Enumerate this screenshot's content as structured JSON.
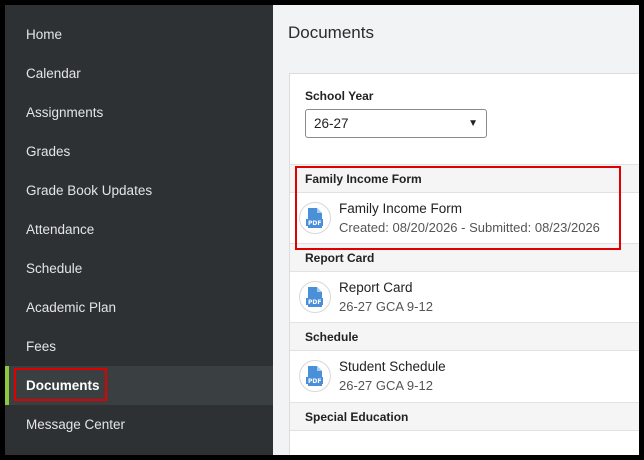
{
  "sidebar": {
    "items": [
      {
        "label": "Home"
      },
      {
        "label": "Calendar"
      },
      {
        "label": "Assignments"
      },
      {
        "label": "Grades"
      },
      {
        "label": "Grade Book Updates"
      },
      {
        "label": "Attendance"
      },
      {
        "label": "Schedule"
      },
      {
        "label": "Academic Plan"
      },
      {
        "label": "Fees"
      },
      {
        "label": "Documents"
      },
      {
        "label": "Message Center"
      }
    ],
    "active": "Documents"
  },
  "main": {
    "title": "Documents",
    "school_year": {
      "label": "School Year",
      "selected": "26-27"
    },
    "sections": [
      {
        "header": "Family Income Form",
        "docs": [
          {
            "title": "Family Income Form",
            "subtitle": "Created: 08/20/2026 - Submitted: 08/23/2026",
            "icon": "pdf-icon"
          }
        ]
      },
      {
        "header": "Report Card",
        "docs": [
          {
            "title": "Report Card",
            "subtitle": "26-27 GCA 9-12",
            "icon": "pdf-icon"
          }
        ]
      },
      {
        "header": "Schedule",
        "docs": [
          {
            "title": "Student Schedule",
            "subtitle": "26-27 GCA 9-12",
            "icon": "pdf-icon"
          }
        ]
      },
      {
        "header": "Special Education",
        "docs": []
      }
    ]
  },
  "colors": {
    "sidebar_bg": "#2d3134",
    "active_accent": "#8dc63f",
    "highlight": "#e00000",
    "pdf_blue": "#4a90d9"
  }
}
